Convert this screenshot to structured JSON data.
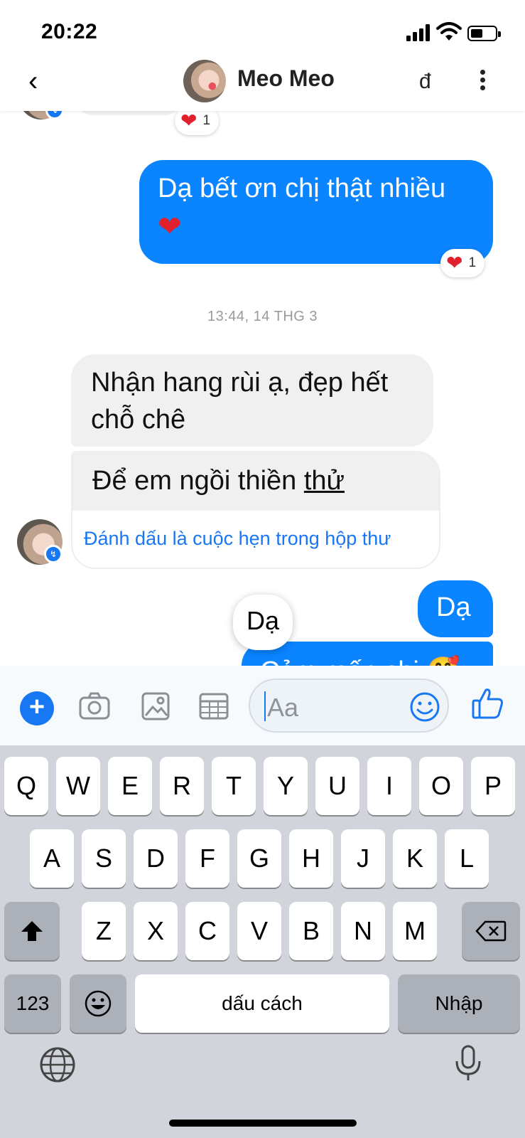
{
  "status_bar": {
    "time": "20:22"
  },
  "header": {
    "contact_name": "Meo Meo",
    "call_glyph": "đ"
  },
  "chat": {
    "top_reaction_count": "1",
    "outgoing_1": {
      "text": "Dạ bết ơn chị thật nhiều",
      "emoji": "❤️",
      "reaction_count": "1"
    },
    "timestamp": "13:44, 14 THG 3",
    "incoming_1": {
      "text_line1": "Nhận hang rùi ạ, đẹp hết",
      "text_line2": "chỗ chê"
    },
    "incoming_2": {
      "text_prefix": "Để em ngồi thiền ",
      "text_underlined": "thử",
      "link": "Đánh dấu là cuộc hẹn trong hộp thư"
    },
    "outgoing_2": {
      "text": "Dạ"
    },
    "outgoing_3_partial": {
      "text": "Cảm mến chị 🥰"
    },
    "floating_bubble": "Dạ"
  },
  "composer": {
    "placeholder": "Aa"
  },
  "keyboard": {
    "row1": [
      "Q",
      "W",
      "E",
      "R",
      "T",
      "Y",
      "U",
      "I",
      "O",
      "P"
    ],
    "row2": [
      "A",
      "S",
      "D",
      "F",
      "G",
      "H",
      "J",
      "K",
      "L"
    ],
    "row3": [
      "Z",
      "X",
      "C",
      "V",
      "B",
      "N",
      "M"
    ],
    "numbers_key": "123",
    "space_key": "dấu cách",
    "return_key": "Nhập"
  },
  "icons": [
    "back-icon",
    "call-icon",
    "more-icon",
    "plus-icon",
    "camera-icon",
    "image-icon",
    "calendar-icon",
    "smile-icon",
    "thumbs-up-icon",
    "shift-icon",
    "backspace-icon",
    "emoji-icon",
    "globe-icon",
    "mic-icon",
    "messenger-badge-icon",
    "heart-icon"
  ],
  "colors": {
    "accent": "#1877f2",
    "outgoing_bubble": "#0a84ff",
    "incoming_bubble": "#f0f0f0",
    "keyboard_bg": "#d1d4da",
    "heart": "#e0202c"
  }
}
